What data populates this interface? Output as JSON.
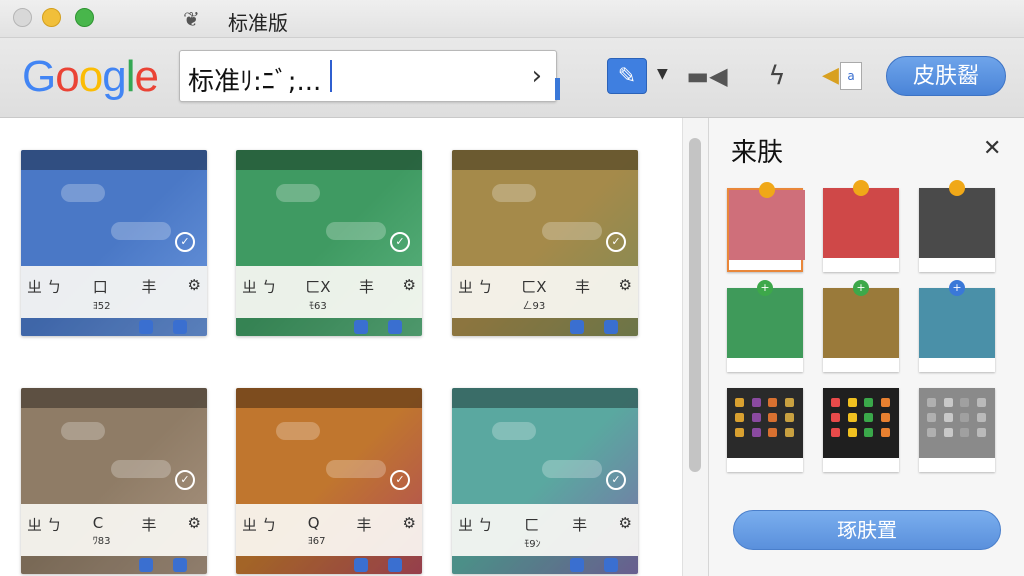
{
  "window": {
    "title": "标准版"
  },
  "toolbar": {
    "logo": {
      "letters": [
        "G",
        "o",
        "o",
        "g",
        "l",
        "e"
      ],
      "colors": [
        "#4285f4",
        "#ea4335",
        "#fbbc05",
        "#4285f4",
        "#34a853",
        "#ea4335"
      ]
    },
    "search": {
      "value": "标准ﾘ:ﾆﾞ;..."
    },
    "skin_button": "皮肤䶛"
  },
  "tiles": [
    {
      "color": "#4a78c6",
      "accent": "#6a96dc",
      "glyphs": [
        "ㄓ ㄅ",
        "口",
        "丰",
        "⚙"
      ],
      "sub": "ﾖ52"
    },
    {
      "color": "#3f9a62",
      "accent": "#5cb37f",
      "glyphs": [
        "ㄓ ㄅ",
        "ㄈX",
        "丰",
        "⚙"
      ],
      "sub": "ﾓ63"
    },
    {
      "color": "#a58a4a",
      "accent": "#7f8a55",
      "glyphs": [
        "ㄓ ㄅ",
        "ㄈX",
        "丰",
        "⚙"
      ],
      "sub": "ㄥ93"
    },
    {
      "color": "#8f7c66",
      "accent": "#a99480",
      "glyphs": [
        "ㄓ ㄅ",
        "C",
        "丰",
        "⚙"
      ],
      "sub": "ﾜ83"
    },
    {
      "color": "#c0762e",
      "accent": "#b04a5a",
      "glyphs": [
        "ㄓ ㄅ",
        "Q",
        "丰",
        "⚙"
      ],
      "sub": "ﾖ67"
    },
    {
      "color": "#5aa8a0",
      "accent": "#7b6fa8",
      "glyphs": [
        "ㄓ ㄅ",
        "ㄈ",
        "丰",
        "⚙"
      ],
      "sub": "ﾓ9ﾝ"
    }
  ],
  "side": {
    "title": "来肤",
    "apply_button": "琢肤置",
    "thumbs": [
      {
        "color": "#cf6f7a",
        "badge": "#f0a818",
        "selected": true
      },
      {
        "color": "#cf4848",
        "badge": "#f0a818",
        "selected": false
      },
      {
        "color": "#4a4a4a",
        "badge": "#f0a818",
        "selected": false
      },
      {
        "color": "#3f9a5a",
        "badge": "#3da84a",
        "selected": false
      },
      {
        "color": "#9a7a3a",
        "badge": "#3da84a",
        "selected": false
      },
      {
        "color": "#4a90a8",
        "badge": "#3a78d8",
        "selected": false
      },
      {
        "color": "#2a2a2a",
        "badge": "",
        "selected": false
      },
      {
        "color": "#1f1f1f",
        "badge": "",
        "selected": false
      },
      {
        "color": "#8a8a8a",
        "badge": "",
        "selected": false
      }
    ]
  }
}
